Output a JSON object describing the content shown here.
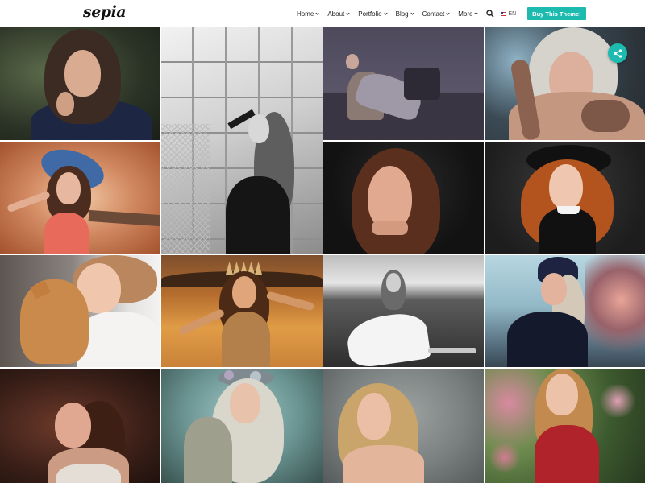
{
  "header": {
    "logo": "sepia",
    "nav": [
      {
        "label": "Home"
      },
      {
        "label": "About"
      },
      {
        "label": "Portfolio"
      },
      {
        "label": "Blog"
      },
      {
        "label": "Contact"
      },
      {
        "label": "More"
      }
    ],
    "search_icon": "search-icon",
    "language": "EN",
    "buy_button": "Buy This Theme!"
  },
  "share_icon": "share-icon",
  "colors": {
    "accent": "#1dbab0",
    "text": "#222222",
    "background": "#ffffff"
  },
  "gallery": {
    "photos": [
      {
        "name": "photo-woman-dark-hair-green-background"
      },
      {
        "name": "photo-woman-black-white-fence"
      },
      {
        "name": "photo-woman-on-chair-dark-room"
      },
      {
        "name": "photo-tattooed-woman-blonde"
      },
      {
        "name": "photo-woman-blue-hat-autumn"
      },
      {
        "name": "photo-woman-brown-hair-dark"
      },
      {
        "name": "photo-redhead-woman-black-hat"
      },
      {
        "name": "photo-woman-with-cat"
      },
      {
        "name": "photo-woman-crown-golden-field"
      },
      {
        "name": "photo-woman-white-dress-field-bw"
      },
      {
        "name": "photo-woman-beanie-street"
      },
      {
        "name": "photo-woman-profile-brown"
      },
      {
        "name": "photo-woman-flower-crown"
      },
      {
        "name": "photo-blonde-woman-grey-background"
      },
      {
        "name": "photo-woman-red-dress-flowers"
      }
    ]
  }
}
